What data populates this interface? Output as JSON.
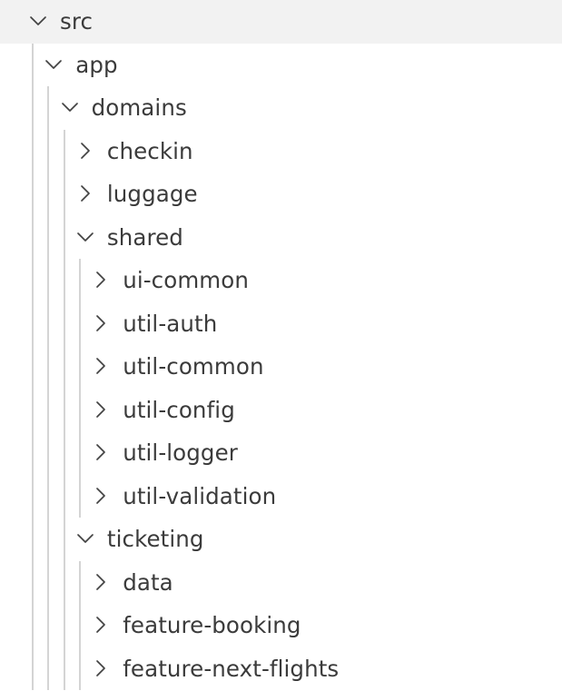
{
  "tree": {
    "nodes": [
      {
        "id": "src",
        "label": "src",
        "depth": 0,
        "expanded": true
      },
      {
        "id": "app",
        "label": "app",
        "depth": 1,
        "expanded": true
      },
      {
        "id": "domains",
        "label": "domains",
        "depth": 2,
        "expanded": true
      },
      {
        "id": "checkin",
        "label": "checkin",
        "depth": 3,
        "expanded": false
      },
      {
        "id": "luggage",
        "label": "luggage",
        "depth": 3,
        "expanded": false
      },
      {
        "id": "shared",
        "label": "shared",
        "depth": 3,
        "expanded": true
      },
      {
        "id": "ui-common",
        "label": "ui-common",
        "depth": 4,
        "expanded": false
      },
      {
        "id": "util-auth",
        "label": "util-auth",
        "depth": 4,
        "expanded": false
      },
      {
        "id": "util-common",
        "label": "util-common",
        "depth": 4,
        "expanded": false
      },
      {
        "id": "util-config",
        "label": "util-config",
        "depth": 4,
        "expanded": false
      },
      {
        "id": "util-logger",
        "label": "util-logger",
        "depth": 4,
        "expanded": false
      },
      {
        "id": "util-validation",
        "label": "util-validation",
        "depth": 4,
        "expanded": false
      },
      {
        "id": "ticketing",
        "label": "ticketing",
        "depth": 3,
        "expanded": true
      },
      {
        "id": "data",
        "label": "data",
        "depth": 4,
        "expanded": false
      },
      {
        "id": "feature-booking",
        "label": "feature-booking",
        "depth": 4,
        "expanded": false
      },
      {
        "id": "feature-next-flights",
        "label": "feature-next-flights",
        "depth": 4,
        "expanded": false
      }
    ]
  },
  "colors": {
    "text": "#3b3b3b",
    "chevron": "#424242",
    "guide": "#d4d4d4",
    "background": "#ffffff"
  },
  "icons": {
    "expanded": "chevron-down-icon",
    "collapsed": "chevron-right-icon"
  }
}
